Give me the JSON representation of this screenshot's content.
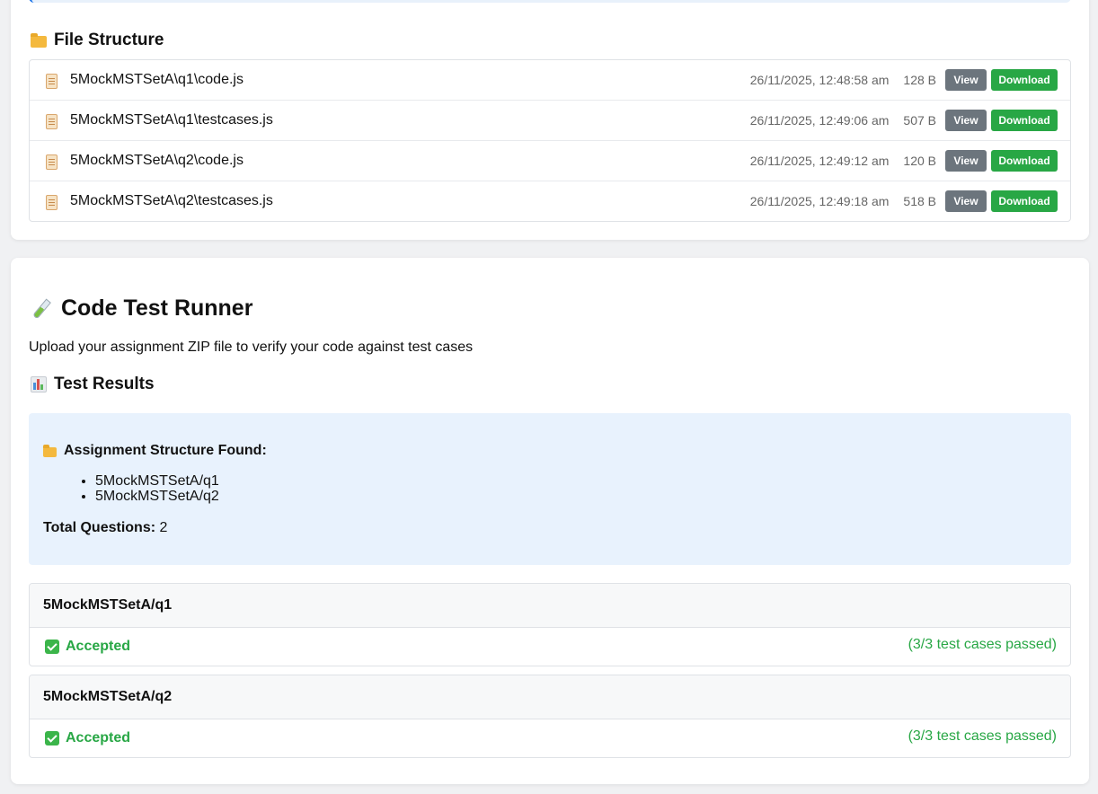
{
  "file_structure": {
    "title": "File Structure",
    "files": [
      {
        "name": "5MockMSTSetA\\q1\\code.js",
        "date": "26/11/2025, 12:48:58 am",
        "size": "128 B"
      },
      {
        "name": "5MockMSTSetA\\q1\\testcases.js",
        "date": "26/11/2025, 12:49:06 am",
        "size": "507 B"
      },
      {
        "name": "5MockMSTSetA\\q2\\code.js",
        "date": "26/11/2025, 12:49:12 am",
        "size": "120 B"
      },
      {
        "name": "5MockMSTSetA\\q2\\testcases.js",
        "date": "26/11/2025, 12:49:18 am",
        "size": "518 B"
      }
    ],
    "view_label": "View",
    "download_label": "Download"
  },
  "runner": {
    "title": "Code Test Runner",
    "description": "Upload your assignment ZIP file to verify your code against test cases"
  },
  "results": {
    "title": "Test Results",
    "structure_heading": "Assignment Structure Found:",
    "structure_items": [
      "5MockMSTSetA/q1",
      "5MockMSTSetA/q2"
    ],
    "total_label": "Total Questions:",
    "total_value": "2",
    "questions": [
      {
        "name": "5MockMSTSetA/q1",
        "status": "Accepted",
        "summary": "(3/3 test cases passed)"
      },
      {
        "name": "5MockMSTSetA/q2",
        "status": "Accepted",
        "summary": "(3/3 test cases passed)"
      }
    ]
  },
  "colors": {
    "accent_blue": "#1a73e8",
    "success_green": "#28a745",
    "view_gray": "#6c757d",
    "info_bg": "#e8f2fd"
  },
  "icons": {
    "folder": "folder-icon",
    "file": "file-icon",
    "test_tube": "test-tube-icon",
    "bar_chart": "bar-chart-icon",
    "check": "check-box-icon"
  }
}
